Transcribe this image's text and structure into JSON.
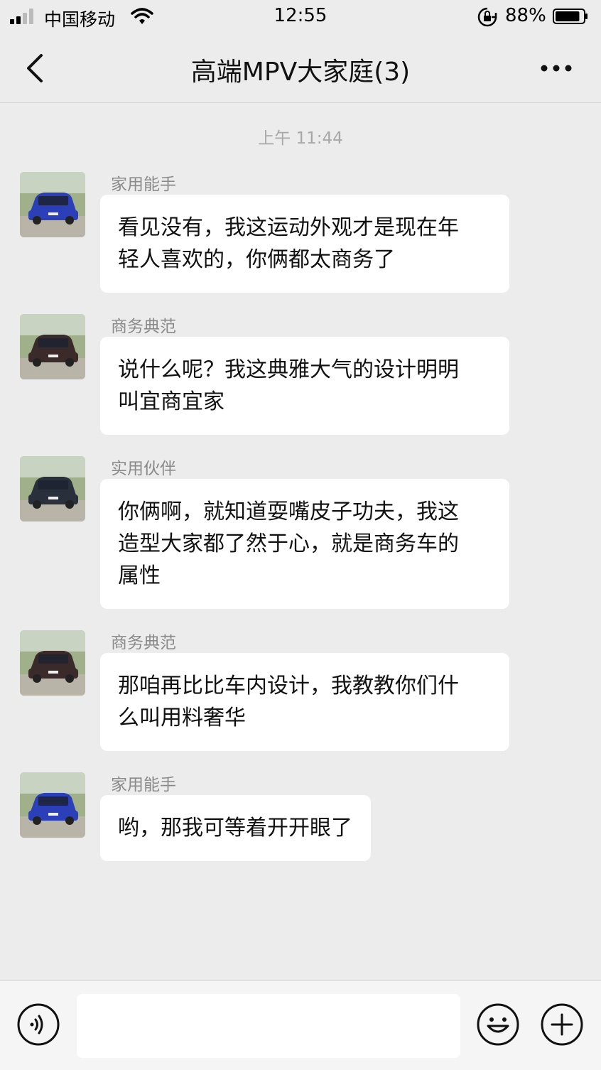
{
  "status_bar": {
    "carrier": "中国移动",
    "time": "12:55",
    "battery": "88%",
    "battery_level": 0.88,
    "icons": [
      "signal-icon",
      "wifi-icon",
      "orientation-lock-icon",
      "battery-icon"
    ]
  },
  "navbar": {
    "title": "高端MPV大家庭(3)",
    "icons": [
      "chevron-left-icon",
      "more-icon"
    ]
  },
  "chat": {
    "timestamp": "上午 11:44",
    "messages": [
      {
        "sender": "家用能手",
        "lines": [
          "看见没有，我这运动外观才是现在年",
          "轻人喜欢的，你俩都太商务了"
        ],
        "avatar_color": "#2b3fb8"
      },
      {
        "sender": "商务典范",
        "lines": [
          "说什么呢？我这典雅大气的设计明明",
          "叫宜商宜家"
        ],
        "avatar_color": "#3a2a2a"
      },
      {
        "sender": "实用伙伴",
        "lines": [
          "你俩啊，就知道耍嘴皮子功夫，我这",
          "造型大家都了然于心，就是商务车的",
          "属性"
        ],
        "avatar_color": "#2a2f3c"
      },
      {
        "sender": "商务典范",
        "lines": [
          "那咱再比比车内设计，我教教你们什",
          "么叫用料奢华"
        ],
        "avatar_color": "#3a2a2a"
      },
      {
        "sender": "家用能手",
        "lines": [
          "哟，那我可等着开开眼了"
        ],
        "avatar_color": "#2b3fb8"
      }
    ]
  },
  "input_bar": {
    "input_value": "",
    "icons": [
      "voice-icon",
      "emoji-icon",
      "plus-icon"
    ]
  }
}
